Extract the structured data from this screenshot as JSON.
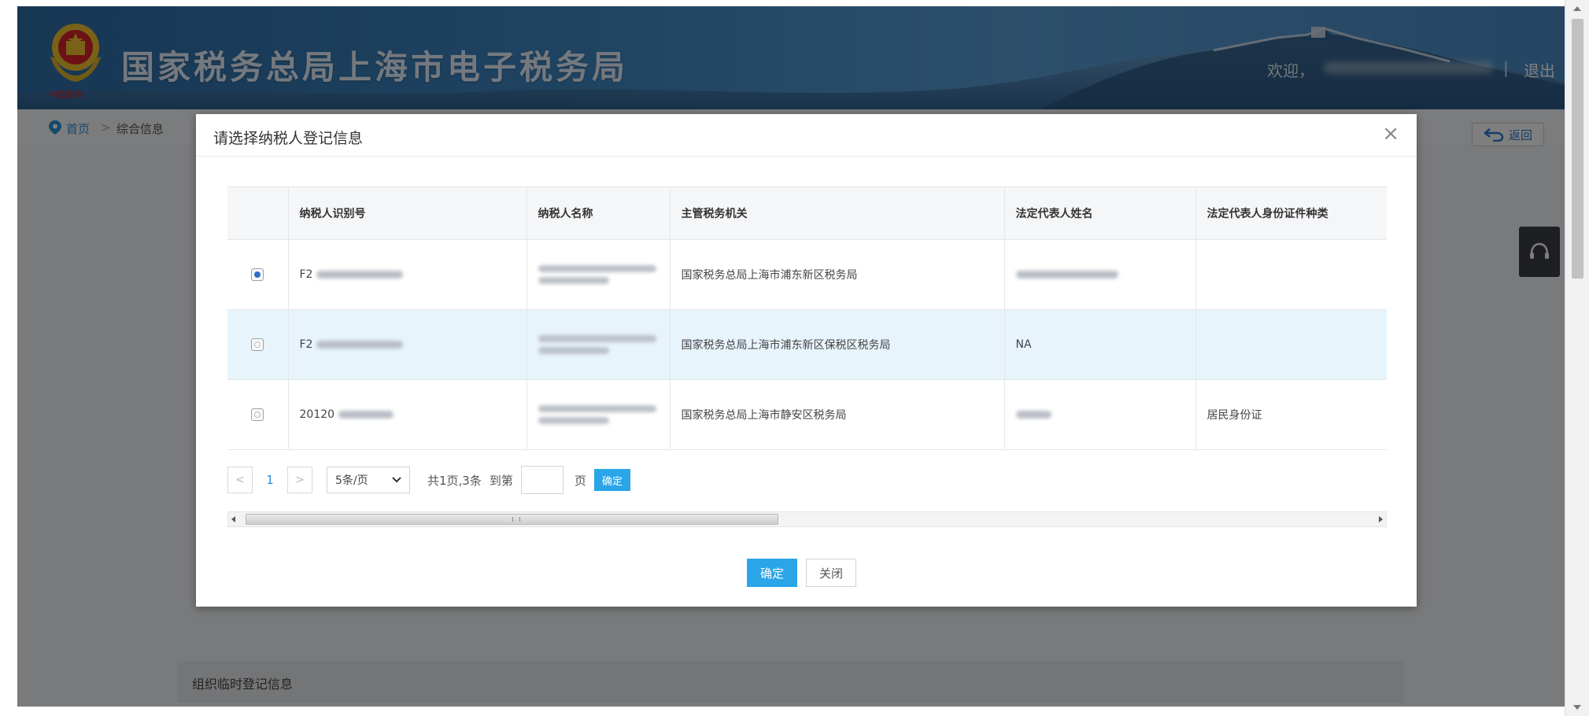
{
  "header": {
    "title": "国家税务总局上海市电子税务局",
    "welcome": "欢迎，",
    "separator": "|",
    "logout": "退出"
  },
  "breadcrumb": {
    "home": "首页",
    "separator": ">",
    "current": "综合信息"
  },
  "back_button": "返回",
  "section_title": "组织临时登记信息",
  "modal": {
    "title": "请选择纳税人登记信息",
    "close": "×",
    "columns": [
      "纳税人识别号",
      "纳税人名称",
      "主管税务机关",
      "法定代表人姓名",
      "法定代表人身份证件种类"
    ],
    "rows": [
      {
        "selected": true,
        "taxpayer_id": "F2",
        "authority": "国家税务总局上海市浦东新区税务局",
        "legal_rep": "",
        "id_type": ""
      },
      {
        "selected": false,
        "taxpayer_id": "F2",
        "authority": "国家税务总局上海市浦东新区保税区税务局",
        "legal_rep": "NA",
        "id_type": ""
      },
      {
        "selected": false,
        "taxpayer_id": "20120",
        "authority": "国家税务总局上海市静安区税务局",
        "legal_rep": "",
        "id_type": "居民身份证"
      }
    ],
    "pager": {
      "prev": "<",
      "current_page": "1",
      "next": ">",
      "page_size": "5条/页",
      "summary": "共1页,3条",
      "goto_label": "到第",
      "page_unit": "页",
      "go": "确定"
    },
    "confirm": "确定",
    "close_button": "关闭"
  },
  "colors": {
    "accent": "#2aa5e8",
    "header_blue": "#3d86c2",
    "selected_row": "#e8f4fc"
  }
}
